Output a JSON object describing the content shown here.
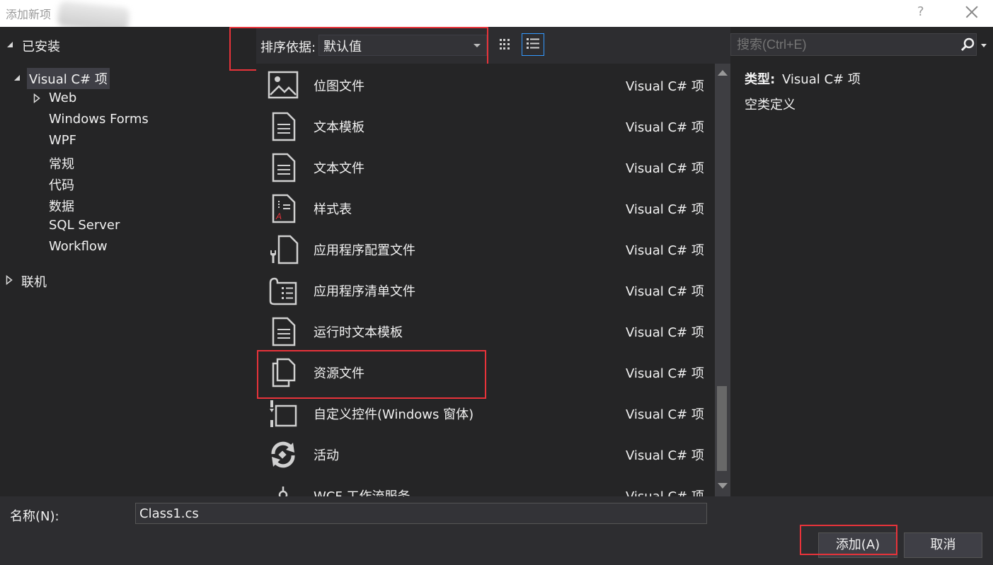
{
  "window": {
    "title": "添加新项",
    "help": "?"
  },
  "tree": {
    "installed": "已安装",
    "visual_csharp": "Visual C# 项",
    "children": [
      "Web",
      "Windows Forms",
      "WPF",
      "常规",
      "代码",
      "数据",
      "SQL Server",
      "Workflow"
    ],
    "online": "联机"
  },
  "toolbar": {
    "sort_label": "排序依据:",
    "sort_value": "默认值"
  },
  "items": [
    {
      "name": "位图文件",
      "type": "Visual C# 项",
      "icon": "bitmap-icon"
    },
    {
      "name": "文本模板",
      "type": "Visual C# 项",
      "icon": "document-icon"
    },
    {
      "name": "文本文件",
      "type": "Visual C# 项",
      "icon": "document-icon"
    },
    {
      "name": "样式表",
      "type": "Visual C# 项",
      "icon": "stylesheet-icon"
    },
    {
      "name": "应用程序配置文件",
      "type": "Visual C# 项",
      "icon": "config-file-icon"
    },
    {
      "name": "应用程序清单文件",
      "type": "Visual C# 项",
      "icon": "manifest-icon"
    },
    {
      "name": "运行时文本模板",
      "type": "Visual C# 项",
      "icon": "document-icon"
    },
    {
      "name": "资源文件",
      "type": "Visual C# 项",
      "icon": "resource-file-icon"
    },
    {
      "name": "自定义控件(Windows 窗体)",
      "type": "Visual C# 项",
      "icon": "custom-control-icon"
    },
    {
      "name": "活动",
      "type": "Visual C# 项",
      "icon": "activity-icon"
    },
    {
      "name": "WCF 工作流服务",
      "type": "Visual C# 项",
      "icon": "wcf-workflow-icon"
    }
  ],
  "search": {
    "placeholder": "搜索(Ctrl+E)"
  },
  "details": {
    "type_label": "类型:",
    "type_value": "Visual C# 项",
    "description": "空类定义"
  },
  "bottom": {
    "name_label": "名称(N):",
    "name_value": "Class1.cs",
    "add_button": "添加(A)",
    "cancel_button": "取消"
  },
  "colors": {
    "highlight_red": "#e8333a",
    "accent_blue": "#3399ff",
    "background": "#2d2d30"
  }
}
